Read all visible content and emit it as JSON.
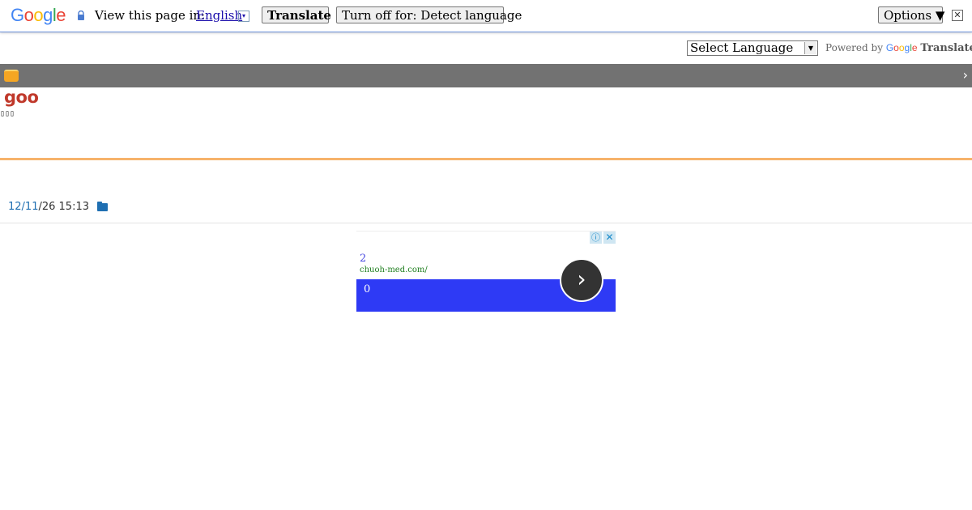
{
  "translate_bar": {
    "logo_letters": [
      {
        "ch": "G",
        "color": "#4285f4"
      },
      {
        "ch": "o",
        "color": "#ea4335"
      },
      {
        "ch": "o",
        "color": "#fbbc05"
      },
      {
        "ch": "g",
        "color": "#4285f4"
      },
      {
        "ch": "l",
        "color": "#34a853"
      },
      {
        "ch": "e",
        "color": "#ea4335"
      }
    ],
    "prompt": "View this page in:",
    "language": "English",
    "language_arrow": "▾",
    "translate_label": "Translate",
    "turn_off_label": "Turn off for: Detect language",
    "options_label": "Options ▼",
    "close_glyph": "✕"
  },
  "language_widget": {
    "selected": "Select Language",
    "powered_prefix": "Powered by",
    "powered_google": "Google",
    "powered_translate": "Translate"
  },
  "site": {
    "logo_text": "goo",
    "tofu_text": "▯▯▯",
    "chevron": "›"
  },
  "post": {
    "date_link": "12/11",
    "date_rest": "/26 15:13"
  },
  "ad": {
    "info_glyph": "ⓘ",
    "close_glyph": "✕",
    "headline": "2",
    "url": "chuoh-med.com/",
    "band_text": "0",
    "arrow_glyph": "›",
    "band_color": "#2e3af5"
  }
}
